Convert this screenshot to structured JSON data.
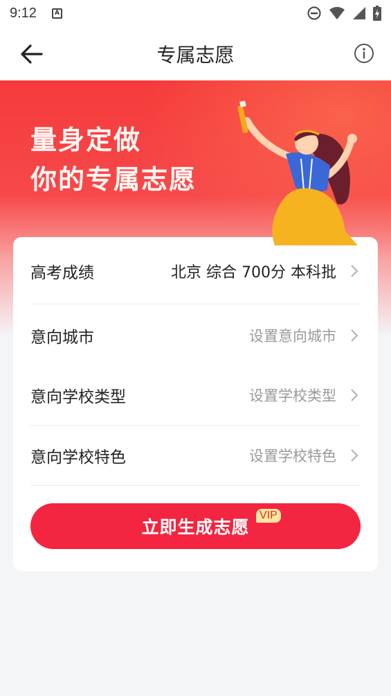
{
  "status_bar": {
    "time": "9:12",
    "notification_icon": "a-icon",
    "icons": [
      "do-not-disturb-icon",
      "wifi-icon",
      "signal-icon",
      "battery-icon"
    ]
  },
  "nav": {
    "title": "专属志愿",
    "back_icon": "back-arrow-icon",
    "info_icon": "info-icon"
  },
  "banner": {
    "line1": "量身定做",
    "line2": "你的专属志愿"
  },
  "form": {
    "rows": [
      {
        "label": "高考成绩",
        "value": "北京 综合 700分 本科批",
        "filled": true
      },
      {
        "label": "意向城市",
        "value": "设置意向城市",
        "filled": false
      },
      {
        "label": "意向学校类型",
        "value": "设置学校类型",
        "filled": false
      },
      {
        "label": "意向学校特色",
        "value": "设置学校特色",
        "filled": false
      }
    ],
    "submit_label": "立即生成志愿",
    "vip_badge": "VIP"
  },
  "colors": {
    "accent": "#f32540",
    "banner_top": "#f53a3b",
    "vip_bg": "#ffe6a3"
  }
}
